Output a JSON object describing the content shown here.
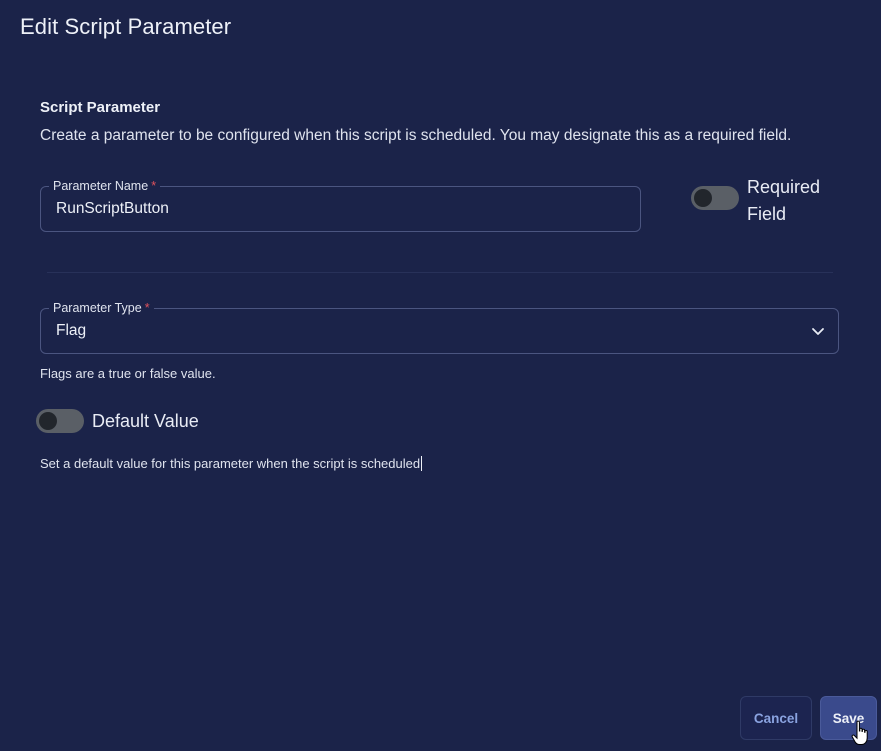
{
  "dialog": {
    "title": "Edit Script Parameter"
  },
  "section": {
    "title": "Script Parameter",
    "description": "Create a parameter to be configured when this script is scheduled. You may designate this as a required field."
  },
  "parameter_name": {
    "label": "Parameter Name",
    "required_marker": "*",
    "value": "RunScriptButton"
  },
  "required_field": {
    "label": "Required Field",
    "enabled": false
  },
  "parameter_type": {
    "label": "Parameter Type",
    "required_marker": "*",
    "selected": "Flag",
    "helper": "Flags are a true or false value."
  },
  "default_value": {
    "label": "Default Value",
    "enabled": false,
    "description": "Set a default value for this parameter when the script is scheduled"
  },
  "buttons": {
    "cancel": "Cancel",
    "save": "Save"
  },
  "icons": {
    "dropdown": "chevron-down-icon",
    "pointer": "hand-pointer-icon"
  },
  "colors": {
    "background": "#1b2349",
    "border": "#4b5580",
    "required_star": "#e0525c",
    "toggle_track": "#5a5f66",
    "cancel_text": "#8aa3e0",
    "save_bg": "#3a4a8c"
  }
}
